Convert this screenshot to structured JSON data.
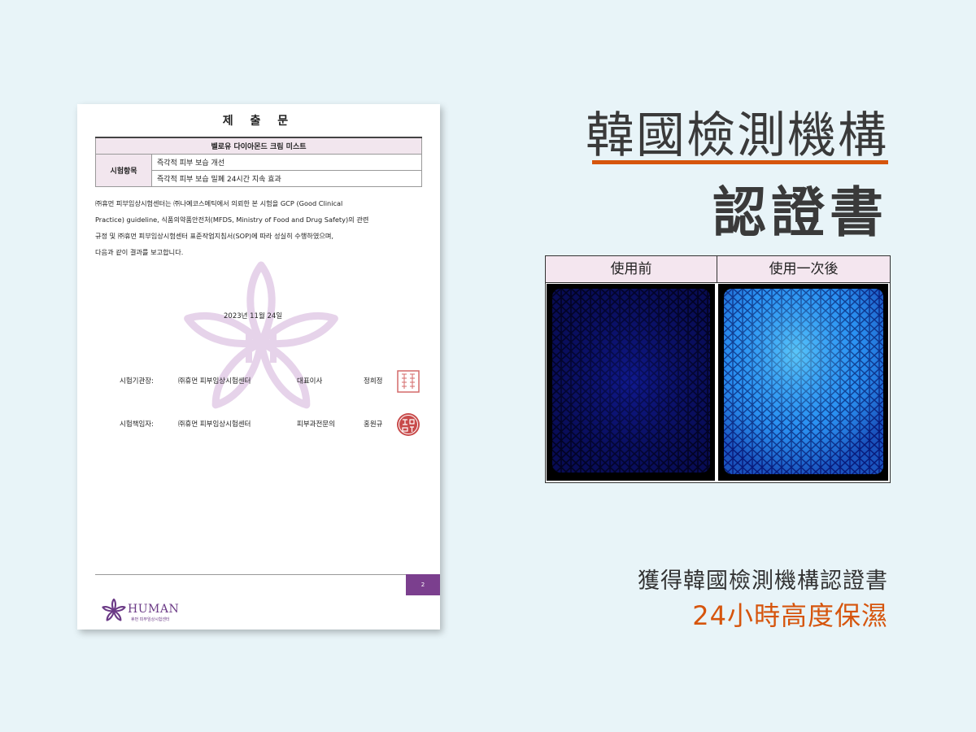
{
  "document": {
    "title": "제 출 문",
    "product": "벨로유 다이아몬드 크림 미스트",
    "test_item_label": "시험항목",
    "test_items": [
      "즉각적 피부 보습 개선",
      "즉각적 피부 보습 밀폐 24시간 지속 효과"
    ],
    "body_lines": [
      "㈜휴먼 피부임상시험센터는 ㈜나예코스메틱에서 의뢰한 본 시험을 GCP (Good Clinical",
      "Practice) guideline, 식품의약품안전처(MFDS, Ministry of Food and Drug Safety)의 관련",
      "규정 및 ㈜휴먼 피부임상시험센터 표준작업지침서(SOP)에 따라 성실히 수행하였으며,",
      "다음과 같이 결과를 보고합니다."
    ],
    "date": "2023년 11월 24일",
    "signatures": [
      {
        "role": "시험기관장:",
        "org": "㈜휴먼 피부임상시험센터",
        "title": "대표이사",
        "name": "정희정"
      },
      {
        "role": "시험책임자:",
        "org": "㈜휴먼 피부임상시험센터",
        "title": "피부과전문의",
        "name": "홍원규"
      }
    ],
    "page_number": "2",
    "logo_name": "HUMAN",
    "logo_sub": "휴먼 피부임상시험센터"
  },
  "heading": {
    "line1": "韓國檢測機構",
    "line2": "認證書"
  },
  "comparison": {
    "before_label": "使用前",
    "after_label": "使用一次後"
  },
  "caption": {
    "line1": "獲得韓國檢測機構認證書",
    "line2": "24小時高度保濕"
  },
  "colors": {
    "accent_orange": "#d6550d",
    "brand_purple": "#7b3f8e",
    "background": "#e8f4f8"
  }
}
